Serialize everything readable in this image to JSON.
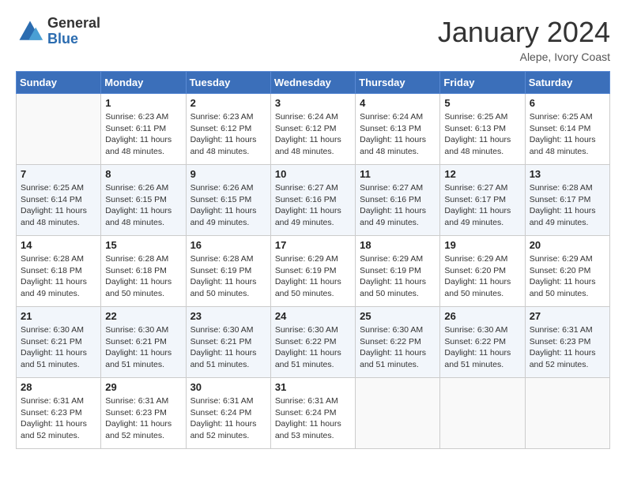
{
  "logo": {
    "general": "General",
    "blue": "Blue"
  },
  "title": "January 2024",
  "location": "Alepe, Ivory Coast",
  "days_of_week": [
    "Sunday",
    "Monday",
    "Tuesday",
    "Wednesday",
    "Thursday",
    "Friday",
    "Saturday"
  ],
  "weeks": [
    [
      {
        "day": "",
        "info": ""
      },
      {
        "day": "1",
        "info": "Sunrise: 6:23 AM\nSunset: 6:11 PM\nDaylight: 11 hours\nand 48 minutes."
      },
      {
        "day": "2",
        "info": "Sunrise: 6:23 AM\nSunset: 6:12 PM\nDaylight: 11 hours\nand 48 minutes."
      },
      {
        "day": "3",
        "info": "Sunrise: 6:24 AM\nSunset: 6:12 PM\nDaylight: 11 hours\nand 48 minutes."
      },
      {
        "day": "4",
        "info": "Sunrise: 6:24 AM\nSunset: 6:13 PM\nDaylight: 11 hours\nand 48 minutes."
      },
      {
        "day": "5",
        "info": "Sunrise: 6:25 AM\nSunset: 6:13 PM\nDaylight: 11 hours\nand 48 minutes."
      },
      {
        "day": "6",
        "info": "Sunrise: 6:25 AM\nSunset: 6:14 PM\nDaylight: 11 hours\nand 48 minutes."
      }
    ],
    [
      {
        "day": "7",
        "info": "Sunrise: 6:25 AM\nSunset: 6:14 PM\nDaylight: 11 hours\nand 48 minutes."
      },
      {
        "day": "8",
        "info": "Sunrise: 6:26 AM\nSunset: 6:15 PM\nDaylight: 11 hours\nand 48 minutes."
      },
      {
        "day": "9",
        "info": "Sunrise: 6:26 AM\nSunset: 6:15 PM\nDaylight: 11 hours\nand 49 minutes."
      },
      {
        "day": "10",
        "info": "Sunrise: 6:27 AM\nSunset: 6:16 PM\nDaylight: 11 hours\nand 49 minutes."
      },
      {
        "day": "11",
        "info": "Sunrise: 6:27 AM\nSunset: 6:16 PM\nDaylight: 11 hours\nand 49 minutes."
      },
      {
        "day": "12",
        "info": "Sunrise: 6:27 AM\nSunset: 6:17 PM\nDaylight: 11 hours\nand 49 minutes."
      },
      {
        "day": "13",
        "info": "Sunrise: 6:28 AM\nSunset: 6:17 PM\nDaylight: 11 hours\nand 49 minutes."
      }
    ],
    [
      {
        "day": "14",
        "info": "Sunrise: 6:28 AM\nSunset: 6:18 PM\nDaylight: 11 hours\nand 49 minutes."
      },
      {
        "day": "15",
        "info": "Sunrise: 6:28 AM\nSunset: 6:18 PM\nDaylight: 11 hours\nand 50 minutes."
      },
      {
        "day": "16",
        "info": "Sunrise: 6:28 AM\nSunset: 6:19 PM\nDaylight: 11 hours\nand 50 minutes."
      },
      {
        "day": "17",
        "info": "Sunrise: 6:29 AM\nSunset: 6:19 PM\nDaylight: 11 hours\nand 50 minutes."
      },
      {
        "day": "18",
        "info": "Sunrise: 6:29 AM\nSunset: 6:19 PM\nDaylight: 11 hours\nand 50 minutes."
      },
      {
        "day": "19",
        "info": "Sunrise: 6:29 AM\nSunset: 6:20 PM\nDaylight: 11 hours\nand 50 minutes."
      },
      {
        "day": "20",
        "info": "Sunrise: 6:29 AM\nSunset: 6:20 PM\nDaylight: 11 hours\nand 50 minutes."
      }
    ],
    [
      {
        "day": "21",
        "info": "Sunrise: 6:30 AM\nSunset: 6:21 PM\nDaylight: 11 hours\nand 51 minutes."
      },
      {
        "day": "22",
        "info": "Sunrise: 6:30 AM\nSunset: 6:21 PM\nDaylight: 11 hours\nand 51 minutes."
      },
      {
        "day": "23",
        "info": "Sunrise: 6:30 AM\nSunset: 6:21 PM\nDaylight: 11 hours\nand 51 minutes."
      },
      {
        "day": "24",
        "info": "Sunrise: 6:30 AM\nSunset: 6:22 PM\nDaylight: 11 hours\nand 51 minutes."
      },
      {
        "day": "25",
        "info": "Sunrise: 6:30 AM\nSunset: 6:22 PM\nDaylight: 11 hours\nand 51 minutes."
      },
      {
        "day": "26",
        "info": "Sunrise: 6:30 AM\nSunset: 6:22 PM\nDaylight: 11 hours\nand 51 minutes."
      },
      {
        "day": "27",
        "info": "Sunrise: 6:31 AM\nSunset: 6:23 PM\nDaylight: 11 hours\nand 52 minutes."
      }
    ],
    [
      {
        "day": "28",
        "info": "Sunrise: 6:31 AM\nSunset: 6:23 PM\nDaylight: 11 hours\nand 52 minutes."
      },
      {
        "day": "29",
        "info": "Sunrise: 6:31 AM\nSunset: 6:23 PM\nDaylight: 11 hours\nand 52 minutes."
      },
      {
        "day": "30",
        "info": "Sunrise: 6:31 AM\nSunset: 6:24 PM\nDaylight: 11 hours\nand 52 minutes."
      },
      {
        "day": "31",
        "info": "Sunrise: 6:31 AM\nSunset: 6:24 PM\nDaylight: 11 hours\nand 53 minutes."
      },
      {
        "day": "",
        "info": ""
      },
      {
        "day": "",
        "info": ""
      },
      {
        "day": "",
        "info": ""
      }
    ]
  ]
}
